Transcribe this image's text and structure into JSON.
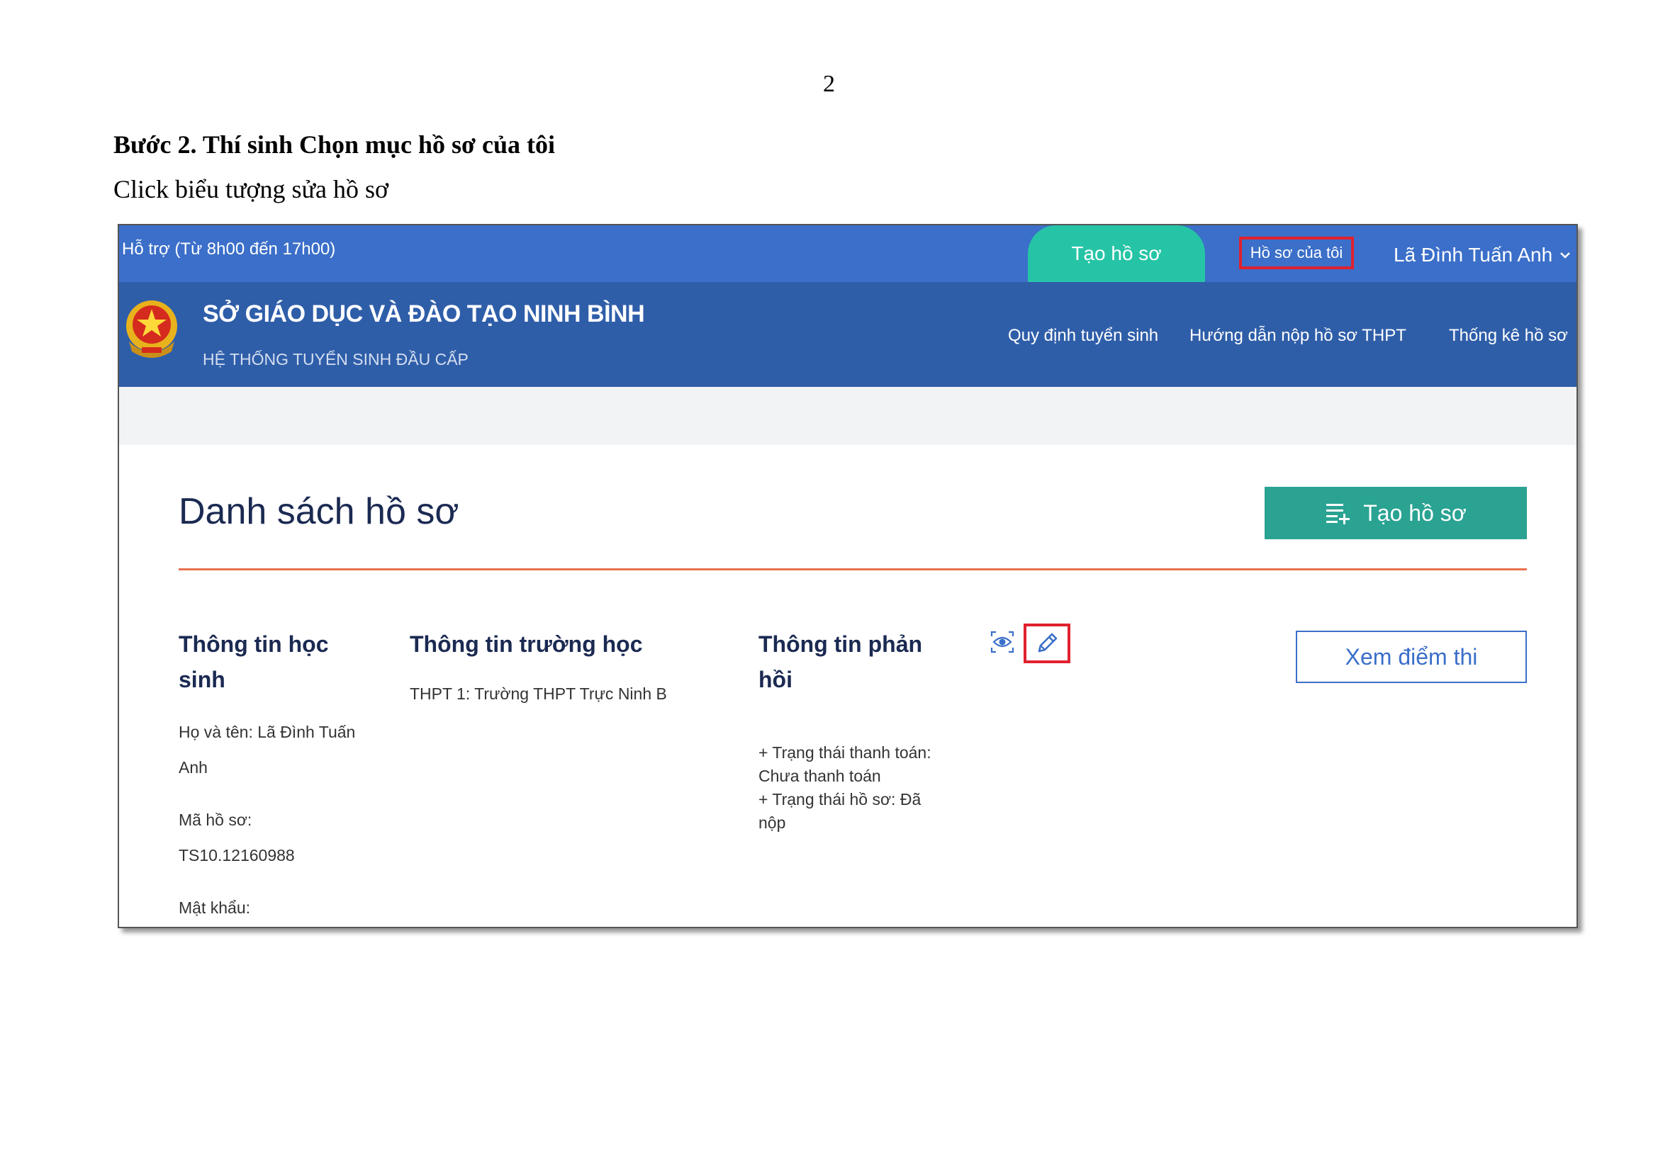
{
  "document": {
    "page_number": "2",
    "step_title": "Bước 2. Thí sinh Chọn mục hồ sơ của tôi",
    "step_description": "Click biểu tượng sửa hồ sơ"
  },
  "topbar": {
    "support": "Hỗ trợ (Từ 8h00 đến 17h00)",
    "create_button": "Tạo hồ sơ",
    "my_profile": "Hồ sơ của tôi",
    "user_name": "Lã Đình Tuấn Anh"
  },
  "header": {
    "org_name": "SỞ GIÁO DỤC VÀ ĐÀO TẠO NINH BÌNH",
    "system_name": "HỆ THỐNG TUYỂN SINH ĐẦU CẤP",
    "nav": [
      {
        "label": "Quy định tuyển sinh"
      },
      {
        "label": "Hướng dẫn nộp hồ sơ THPT"
      },
      {
        "label": "Thống kê hồ sơ"
      }
    ]
  },
  "main": {
    "title": "Danh sách hồ sơ",
    "create_button": "Tạo hồ sơ",
    "columns": {
      "student_heading_1": "Thông tin học",
      "student_heading_2": "sinh",
      "school_heading": "Thông tin trường học",
      "feedback_heading_1": "Thông tin phản",
      "feedback_heading_2": "hồi"
    },
    "student": {
      "name_line1": "Họ và tên: Lã Đình Tuấn",
      "name_line2": "Anh",
      "code_label": "Mã hồ sơ:",
      "code_value": "TS10.12160988",
      "password_label": "Mật khẩu:"
    },
    "school": {
      "choice": "THPT 1: Trường THPT Trực Ninh B"
    },
    "feedback": {
      "payment_status_label": "+ Trạng thái thanh toán:",
      "payment_status_value": "Chưa thanh toán",
      "profile_status_label": "+ Trạng thái hồ sơ: Đã",
      "profile_status_value": "nộp"
    },
    "view_scores_button": "Xem điểm thi"
  },
  "colors": {
    "topbar": "#3b6fc9",
    "header": "#2f5ea9",
    "create_top": "#26c4a6",
    "create_main": "#2aa393",
    "highlight": "#e0212e",
    "divider": "#e8714f",
    "title": "#1b2a52"
  },
  "icons": [
    "national-emblem-icon",
    "chevron-down-icon",
    "list-add-icon",
    "eye-icon",
    "pencil-icon"
  ]
}
